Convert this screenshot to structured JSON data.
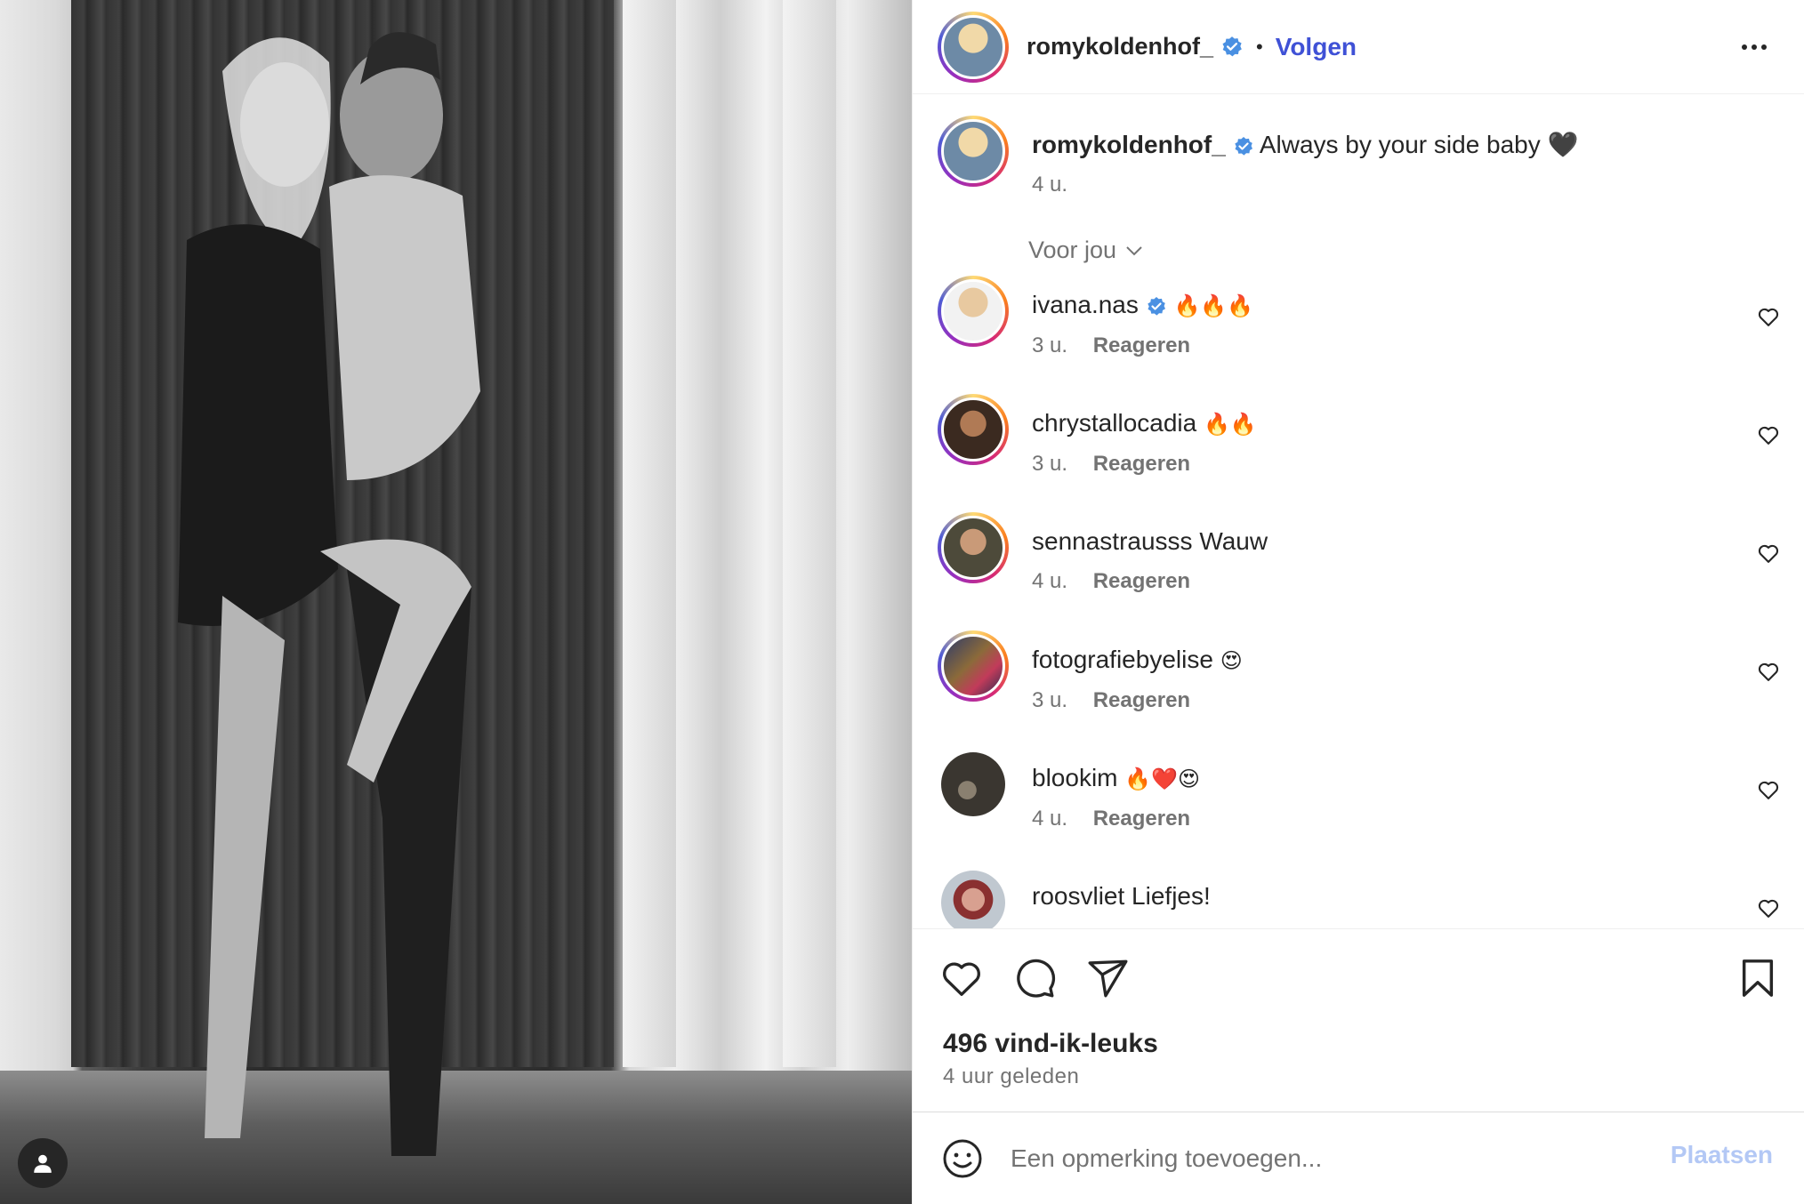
{
  "post": {
    "author": "romykoldenhof_",
    "follow_label": "Volgen",
    "separator": "•",
    "caption": "Always by your side baby 🖤",
    "caption_time": "4 u.",
    "sort_label": "Voor jou",
    "likes": "496 vind-ik-leuks",
    "posted_ago": "4 uur geleden"
  },
  "comments": [
    {
      "user": "ivana.nas",
      "verified": true,
      "text": "🔥🔥🔥",
      "time": "3 u.",
      "reply": "Reageren"
    },
    {
      "user": "chrystallocadia",
      "verified": false,
      "text": "🔥🔥",
      "time": "3 u.",
      "reply": "Reageren"
    },
    {
      "user": "sennastrausss",
      "verified": false,
      "text": "Wauw",
      "time": "4 u.",
      "reply": "Reageren"
    },
    {
      "user": "fotografiebyelise",
      "verified": false,
      "text": "😍",
      "time": "3 u.",
      "reply": "Reageren"
    },
    {
      "user": "blookim",
      "verified": false,
      "text": "🔥❤️😍",
      "time": "4 u.",
      "reply": "Reageren"
    },
    {
      "user": "roosvliet",
      "verified": false,
      "text": "Liefjes!",
      "time": "",
      "reply": ""
    }
  ],
  "composer": {
    "placeholder": "Een opmerking toevoegen...",
    "post_label": "Plaatsen"
  },
  "colors": {
    "link_blue": "#3f51d6",
    "verified_blue": "#4a90e2",
    "post_disabled": "#b3c8f5",
    "muted_text": "#737373"
  },
  "icons": [
    "more-icon",
    "verified-icon",
    "chevron-down-icon",
    "heart-icon",
    "comment-icon",
    "share-icon",
    "bookmark-icon",
    "emoji-icon",
    "user-icon"
  ]
}
